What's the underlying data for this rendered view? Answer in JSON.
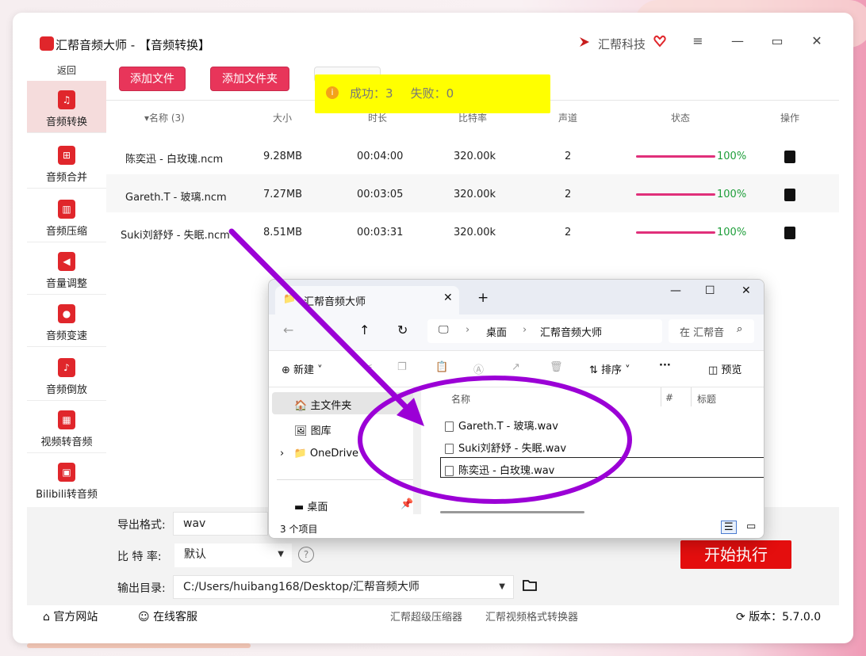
{
  "app": {
    "title": "汇帮音频大师 - 【音频转换】",
    "brand": "汇帮科技",
    "back": "返回"
  },
  "sidebar": {
    "items": [
      {
        "label": "音频转换",
        "icon": "audio-convert-icon",
        "active": true
      },
      {
        "label": "音频合并",
        "icon": "audio-merge-icon"
      },
      {
        "label": "音频压缩",
        "icon": "audio-compress-icon"
      },
      {
        "label": "音量调整",
        "icon": "volume-icon"
      },
      {
        "label": "音频变速",
        "icon": "mic-icon"
      },
      {
        "label": "音频倒放",
        "icon": "music-note-icon"
      },
      {
        "label": "视频转音频",
        "icon": "film-icon"
      },
      {
        "label": "Bilibili转音频",
        "icon": "bilibili-icon"
      }
    ]
  },
  "toolbar": {
    "add_file": "添加文件",
    "add_folder": "添加文件夹"
  },
  "toast": {
    "success_label": "成功：",
    "success_count": "3",
    "fail_label": "失败：",
    "fail_count": "0"
  },
  "table": {
    "headers": {
      "name": "▾名称 (3)",
      "size": "大小",
      "duration": "时长",
      "bitrate": "比特率",
      "channels": "声道",
      "status": "状态",
      "action": "操作"
    },
    "rows": [
      {
        "name": "陈奕迅 - 白玫瑰.ncm",
        "size": "9.28MB",
        "duration": "00:04:00",
        "bitrate": "320.00k",
        "channels": "2",
        "progress": "100%"
      },
      {
        "name": "Gareth.T - 玻璃.ncm",
        "size": "7.27MB",
        "duration": "00:03:05",
        "bitrate": "320.00k",
        "channels": "2",
        "progress": "100%"
      },
      {
        "name": "Suki刘舒妤 - 失眠.ncm",
        "size": "8.51MB",
        "duration": "00:03:31",
        "bitrate": "320.00k",
        "channels": "2",
        "progress": "100%"
      }
    ]
  },
  "settings": {
    "format_label": "导出格式:",
    "format_value": "wav",
    "bitrate_label": "比 特 率:",
    "bitrate_value": "默认",
    "output_label": "输出目录:",
    "output_value": "C:/Users/huibang168/Desktop/汇帮音频大师",
    "start": "开始执行"
  },
  "footer": {
    "website": "官方网站",
    "support": "在线客服",
    "link1": "汇帮超级压缩器",
    "link2": "汇帮视频格式转换器",
    "version": "版本：5.7.0.0"
  },
  "explorer": {
    "tab_title": "汇帮音频大师",
    "crumb1": "桌面",
    "crumb2": "汇帮音频大师",
    "search_placeholder": "在 汇帮音",
    "new": "新建",
    "sort": "排序",
    "more": "···",
    "preview": "预览",
    "nav": [
      "主文件夹",
      "图库",
      "OneDrive",
      "桌面"
    ],
    "col_name": "名称",
    "col_num": "#",
    "col_title": "标题",
    "files": [
      "Gareth.T - 玻璃.wav",
      "Suki刘舒妤 - 失眠.wav",
      "陈奕迅 - 白玫瑰.wav"
    ],
    "status": "3 个项目"
  },
  "colors": {
    "accent_red": "#e8355a",
    "progress": "#e0307a",
    "success_green": "#1e9e3a",
    "toast_bg": "#ffff00",
    "annotation_purple": "#9b00d6"
  }
}
